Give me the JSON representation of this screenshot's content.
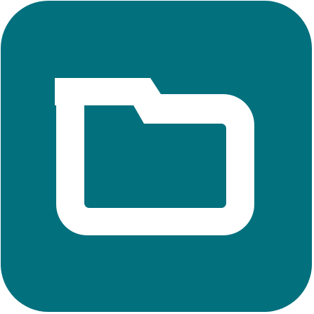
{
  "icon": {
    "name": "folder-icon",
    "background_color": "#03707E",
    "foreground_color": "#FFFFFF"
  }
}
